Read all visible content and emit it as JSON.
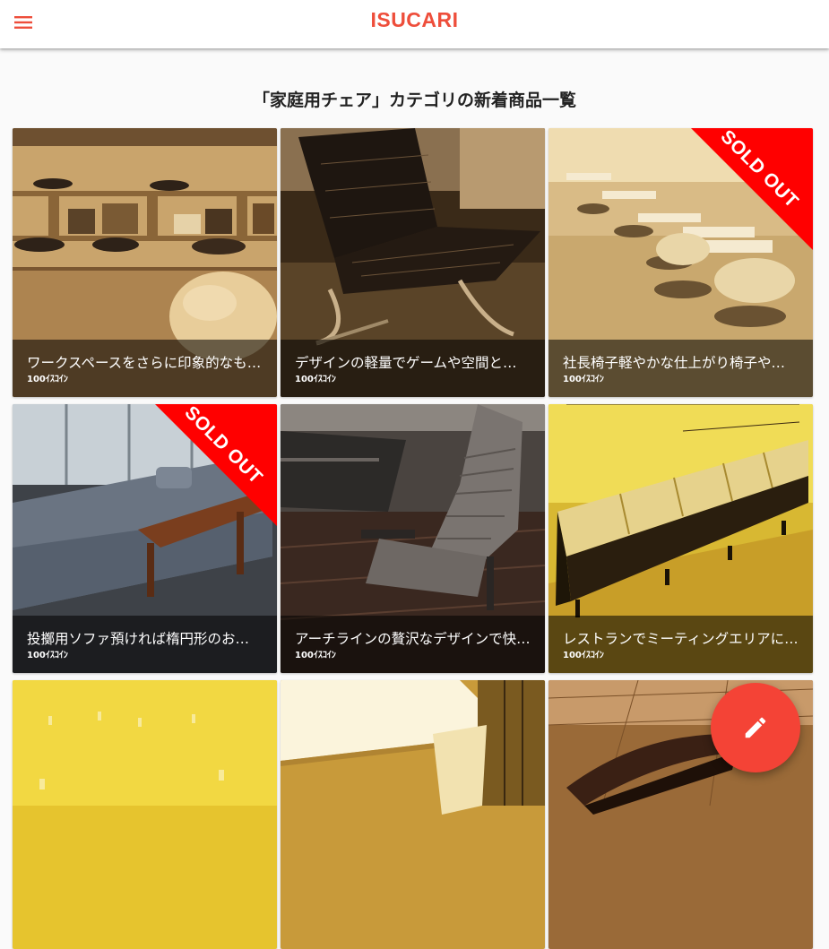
{
  "app": {
    "brand": "ISUCARI",
    "brand_color": "#ee4e3b",
    "menu_icon": "menu-icon"
  },
  "page": {
    "title": "「家庭用チェア」カテゴリの新着商品一覧"
  },
  "colors": {
    "ribbon": "#ff0000",
    "fab": "#f44336",
    "caption_overlay": "rgba(0,0,0,0.55)"
  },
  "items": [
    {
      "name": "ワークスペースをさらに印象的なものに",
      "price": "100ｲｽｺｲﾝ",
      "sold_out": false
    },
    {
      "name": "デザインの軽量でゲームや空間と調和する",
      "price": "100ｲｽｺｲﾝ",
      "sold_out": false
    },
    {
      "name": "社長椅子軽やかな仕上がり椅子やソファ",
      "price": "100ｲｽｺｲﾝ",
      "sold_out": true
    },
    {
      "name": "投擲用ソファ預ければ楕円形のおしゃれな",
      "price": "100ｲｽｺｲﾝ",
      "sold_out": true
    },
    {
      "name": "アーチラインの贅沢なデザインで快適に",
      "price": "100ｲｽｺｲﾝ",
      "sold_out": false
    },
    {
      "name": "レストランでミーティングエリアにも最適",
      "price": "100ｲｽｺｲﾝ",
      "sold_out": false
    },
    {
      "name": "",
      "price": "",
      "sold_out": false
    },
    {
      "name": "",
      "price": "",
      "sold_out": false
    },
    {
      "name": "",
      "price": "",
      "sold_out": false
    }
  ],
  "sold_out_label": "SOLD OUT",
  "fab": {
    "icon": "pencil-icon"
  }
}
